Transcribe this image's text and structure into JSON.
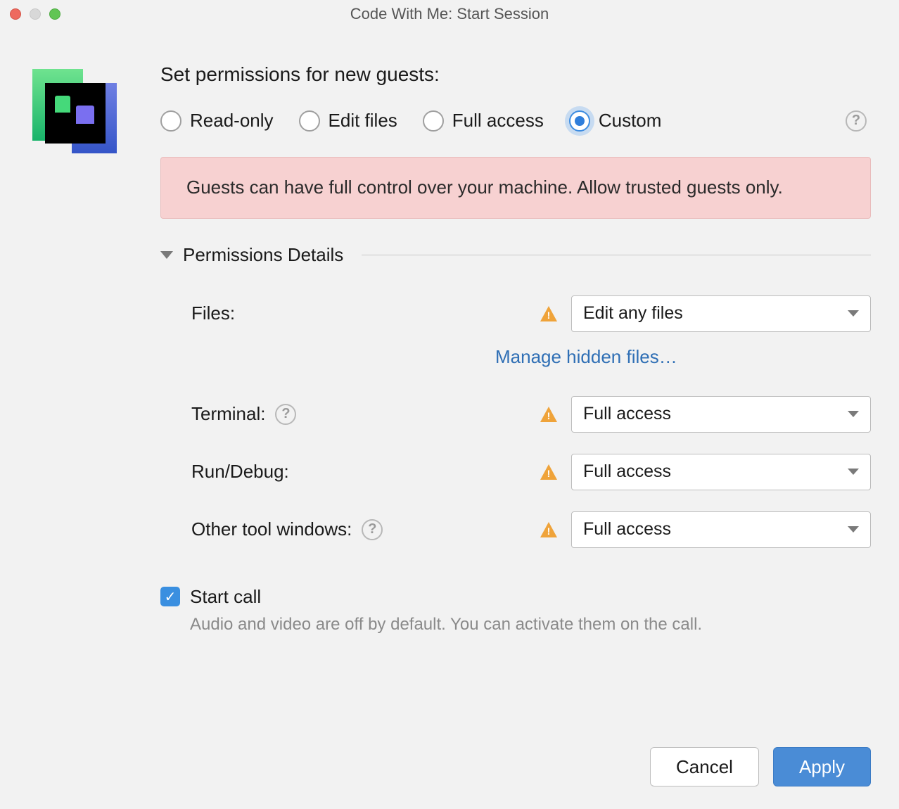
{
  "window": {
    "title": "Code With Me: Start Session"
  },
  "header": {
    "permissions_heading": "Set permissions for new guests:"
  },
  "radios": {
    "read_only": "Read-only",
    "edit_files": "Edit files",
    "full_access": "Full access",
    "custom": "Custom",
    "selected": "custom"
  },
  "warning": {
    "text": "Guests can have full control over your machine. Allow trusted guests only."
  },
  "section": {
    "title": "Permissions Details"
  },
  "perm": {
    "files_label": "Files:",
    "files_value": "Edit any files",
    "manage_hidden": "Manage hidden files…",
    "terminal_label": "Terminal:",
    "terminal_value": "Full access",
    "run_label": "Run/Debug:",
    "run_value": "Full access",
    "other_label": "Other tool windows:",
    "other_value": "Full access"
  },
  "start_call": {
    "label": "Start call",
    "hint": "Audio and video are off by default. You can activate them on the call.",
    "checked": true
  },
  "buttons": {
    "cancel": "Cancel",
    "apply": "Apply"
  },
  "icons": {
    "help": "?",
    "check": "✓"
  }
}
